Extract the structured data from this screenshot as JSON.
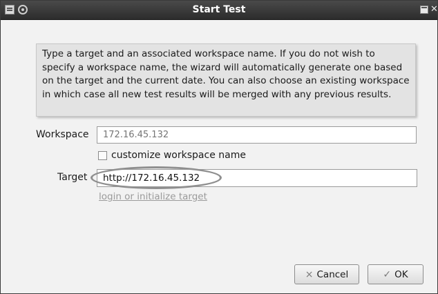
{
  "window": {
    "title": "Start Test"
  },
  "info": {
    "text": "Type a target and an associated workspace name. If you do not wish to specify a workspace name, the wizard will automatically generate one based on the target and the current date. You can also choose an existing workspace in which case all new test results will be merged with any previous results."
  },
  "form": {
    "workspace_label": "Workspace",
    "workspace_placeholder": "172.16.45.132",
    "customize_label": "customize workspace name",
    "customize_checked": false,
    "target_label": "Target",
    "target_value": "http://172.16.45.132",
    "login_link": "login or initialize target"
  },
  "buttons": {
    "cancel_label": "Cancel",
    "cancel_icon": "×",
    "ok_label": "OK",
    "ok_icon": "✓"
  },
  "icons": {
    "menu": "window-menu-icon",
    "pin": "pin-icon",
    "maximize": "maximize-icon",
    "close": "close-icon"
  },
  "colors": {
    "titlebar": "#2c2c2c",
    "info_background": "#e3e3e3",
    "highlight_ring": "#8f8f8f",
    "link": "#9a9a9a"
  }
}
